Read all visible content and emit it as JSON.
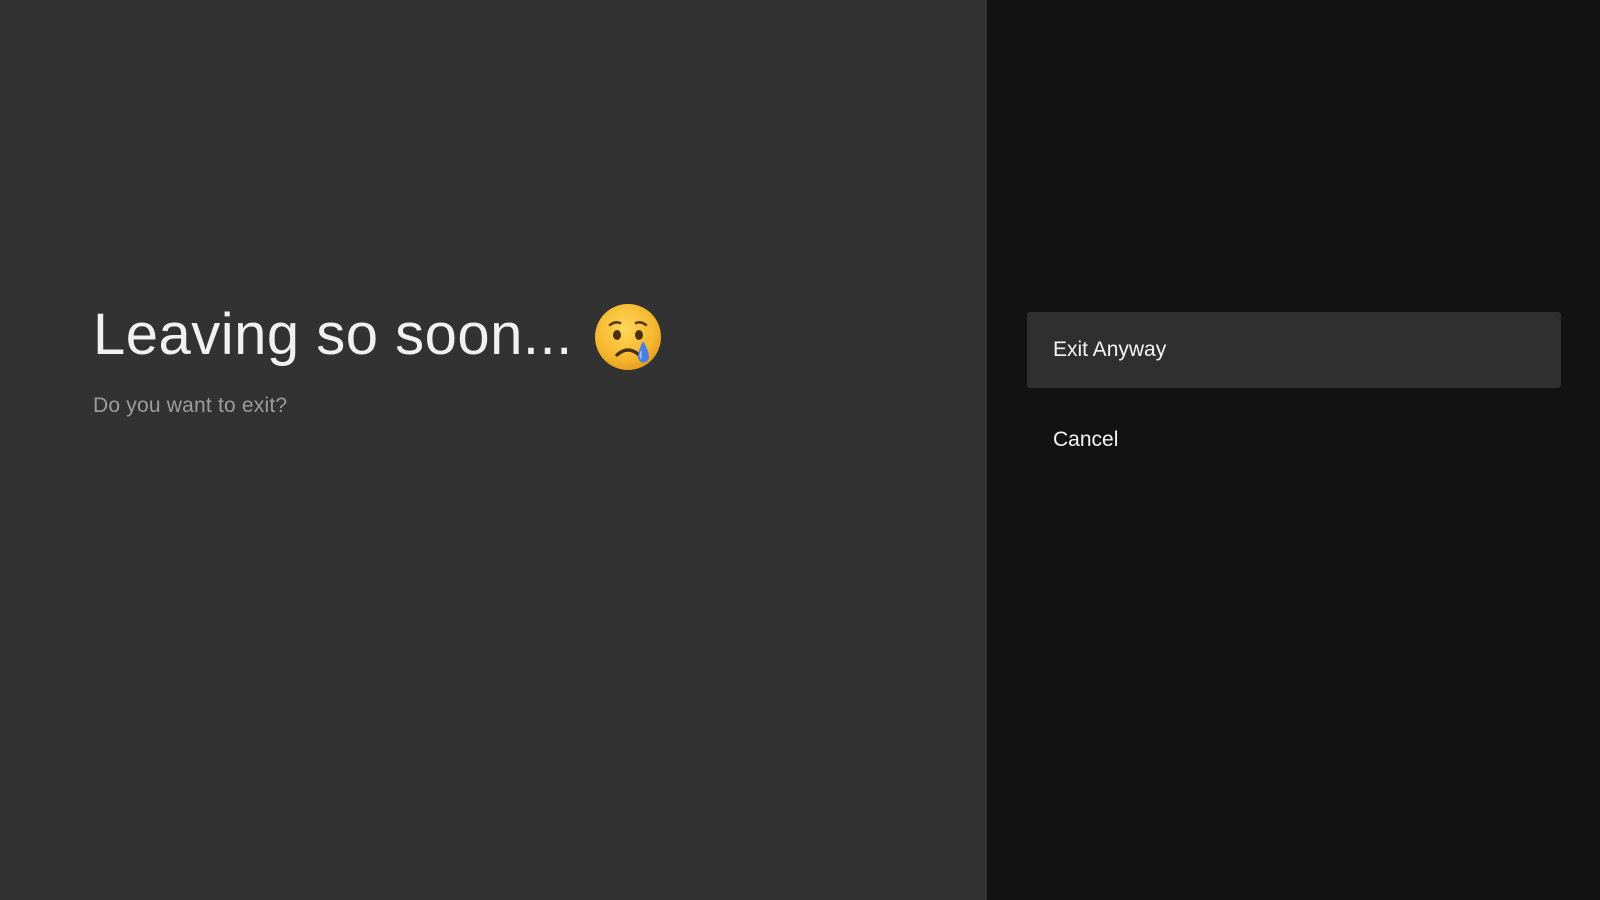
{
  "guidance": {
    "title": "Leaving so soon...",
    "emoji_icon": "crying-face-icon",
    "subtitle": "Do you want to exit?"
  },
  "actions": {
    "items": [
      {
        "label": "Exit Anyway",
        "focused": true
      },
      {
        "label": "Cancel",
        "focused": false
      }
    ]
  },
  "colors": {
    "left_background": "#323232",
    "right_background": "#121212",
    "focused_item_background": "#2f2f2f",
    "title_color": "#f1f1f1",
    "subtitle_color": "#9c9c9c",
    "emoji_face": "#f5b72e",
    "emoji_tear": "#4c7ee6"
  }
}
